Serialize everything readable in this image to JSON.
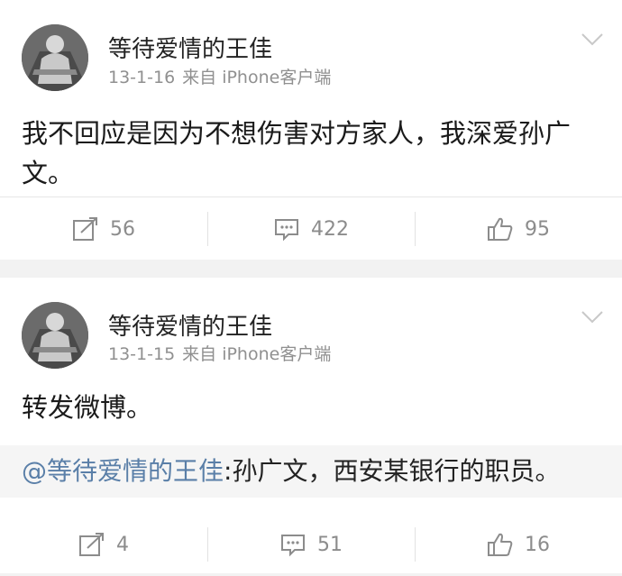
{
  "posts": [
    {
      "username": "等待爱情的王佳",
      "date": "13-1-16",
      "source": "来自 iPhone客户端",
      "text": "我不回应是因为不想伤害对方家人，我深爱孙广文。",
      "repost_count": "56",
      "comment_count": "422",
      "like_count": "95"
    },
    {
      "username": "等待爱情的王佳",
      "date": "13-1-15",
      "source": "来自 iPhone客户端",
      "text": "转发微博。",
      "quoted_mention": "@等待爱情的王佳",
      "quoted_text": ":孙广文，西安某银行的职员。",
      "repost_count": "4",
      "comment_count": "51",
      "like_count": "16"
    }
  ],
  "icons": {
    "repost": "edit-share-icon",
    "comment": "comment-bubble-icon",
    "like": "thumbs-up-icon",
    "menu": "chevron-down-icon"
  },
  "colors": {
    "mention": "#5a7fa8",
    "meta": "#909090",
    "background": "#f2f2f2"
  }
}
